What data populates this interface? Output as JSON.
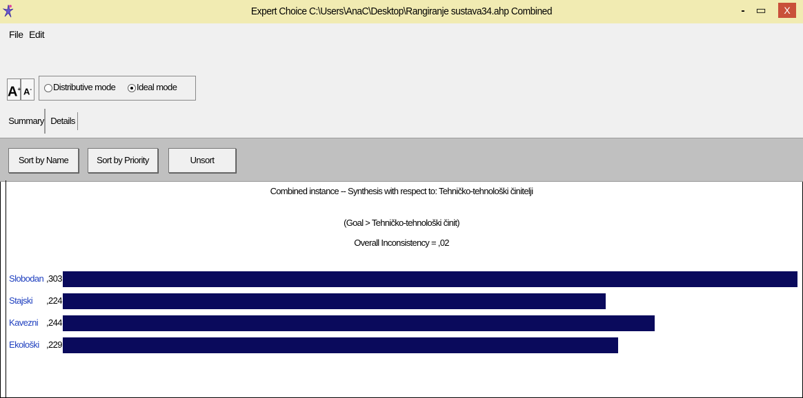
{
  "window": {
    "title": "Expert Choice    C:\\Users\\AnaC\\Desktop\\Rangiranje sustava34.ahp   Combined",
    "minimize_glyph": "-",
    "maximize_glyph": "▭",
    "close_glyph": "X",
    "close_color": "#c9503a"
  },
  "menu": {
    "file": "File",
    "edit": "Edit"
  },
  "toolbar": {
    "font_increase": "A",
    "font_decrease": "A",
    "mode_distributive": "Distributive mode",
    "mode_ideal": "Ideal mode",
    "selected_mode": "ideal"
  },
  "tabs": {
    "summary": "Summary",
    "details": "Details",
    "active": "summary"
  },
  "sort_buttons": {
    "by_name": "Sort by Name",
    "by_priority": "Sort by Priority",
    "unsort": "Unsort"
  },
  "synthesis": {
    "line1": "Combined instance -- Synthesis with respect to: Tehničko-tehnološki činitelji",
    "line2": "(Goal > Tehničko-tehnološki činit)",
    "line3": "Overall Inconsistency = ,02"
  },
  "chart_data": {
    "type": "bar",
    "orientation": "horizontal",
    "bar_color": "#0a0a5c",
    "categories": [
      "Slobodan",
      "Stajski",
      "Kavezni",
      "Ekološki"
    ],
    "value_labels": [
      ",303",
      ",224",
      ",244",
      ",229"
    ],
    "values": [
      0.303,
      0.224,
      0.244,
      0.229
    ]
  }
}
